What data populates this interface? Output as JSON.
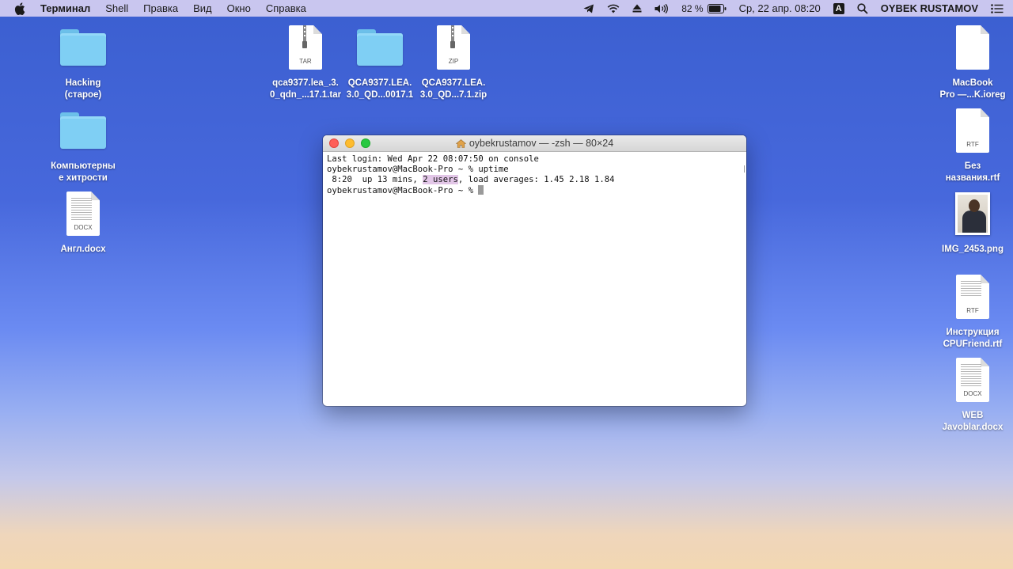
{
  "menubar": {
    "app_name": "Терминал",
    "items": [
      "Shell",
      "Правка",
      "Вид",
      "Окно",
      "Справка"
    ],
    "battery_percent": "82 %",
    "datetime": "Ср, 22 апр.  08:20",
    "input_source": "A",
    "user": "OYBEK RUSTAMOV",
    "icons": [
      "apple-icon",
      "telegram-icon",
      "wifi-icon",
      "eject-icon",
      "volume-icon",
      "battery-icon",
      "search-icon",
      "list-icon"
    ]
  },
  "desktop": {
    "hacking_folder": "Hacking\n(старое)",
    "computer_tricks_folder": "Компьютерны\nе хитрости",
    "angl_docx": "Англ.docx",
    "angl_docx_ext": "DOCX",
    "qca_tar": "qca9377.lea_.3.\n0_qdn_...17.1.tar",
    "qca_tar_ext": "TAR",
    "qca_folder": "QCA9377.LEA.\n3.0_QD...0017.1",
    "qca_zip": "QCA9377.LEA.\n3.0_QD...7.1.zip",
    "qca_zip_ext": "ZIP",
    "macbook_ioreg": "MacBook\nPro —...K.ioreg",
    "untitled_rtf": "Без\nназвания.rtf",
    "untitled_rtf_ext": "RTF",
    "img_png": "IMG_2453.png",
    "cpufriend_rtf": "Инструкция\nCPUFriend.rtf",
    "cpufriend_rtf_ext": "RTF",
    "web_docx": "WEB\nJavoblar.docx",
    "web_docx_ext": "DOCX"
  },
  "terminal": {
    "title": "oybekrustamov — -zsh — 80×24",
    "line1": "Last login: Wed Apr 22 08:07:50 on console",
    "line2": "oybekrustamov@MacBook-Pro ~ % uptime",
    "line3_pre": " 8:20  up 13 mins, ",
    "line3_hl": "2 users",
    "line3_post": ", load averages: 1.45 2.18 1.84",
    "line4": "oybekrustamov@MacBook-Pro ~ % "
  }
}
